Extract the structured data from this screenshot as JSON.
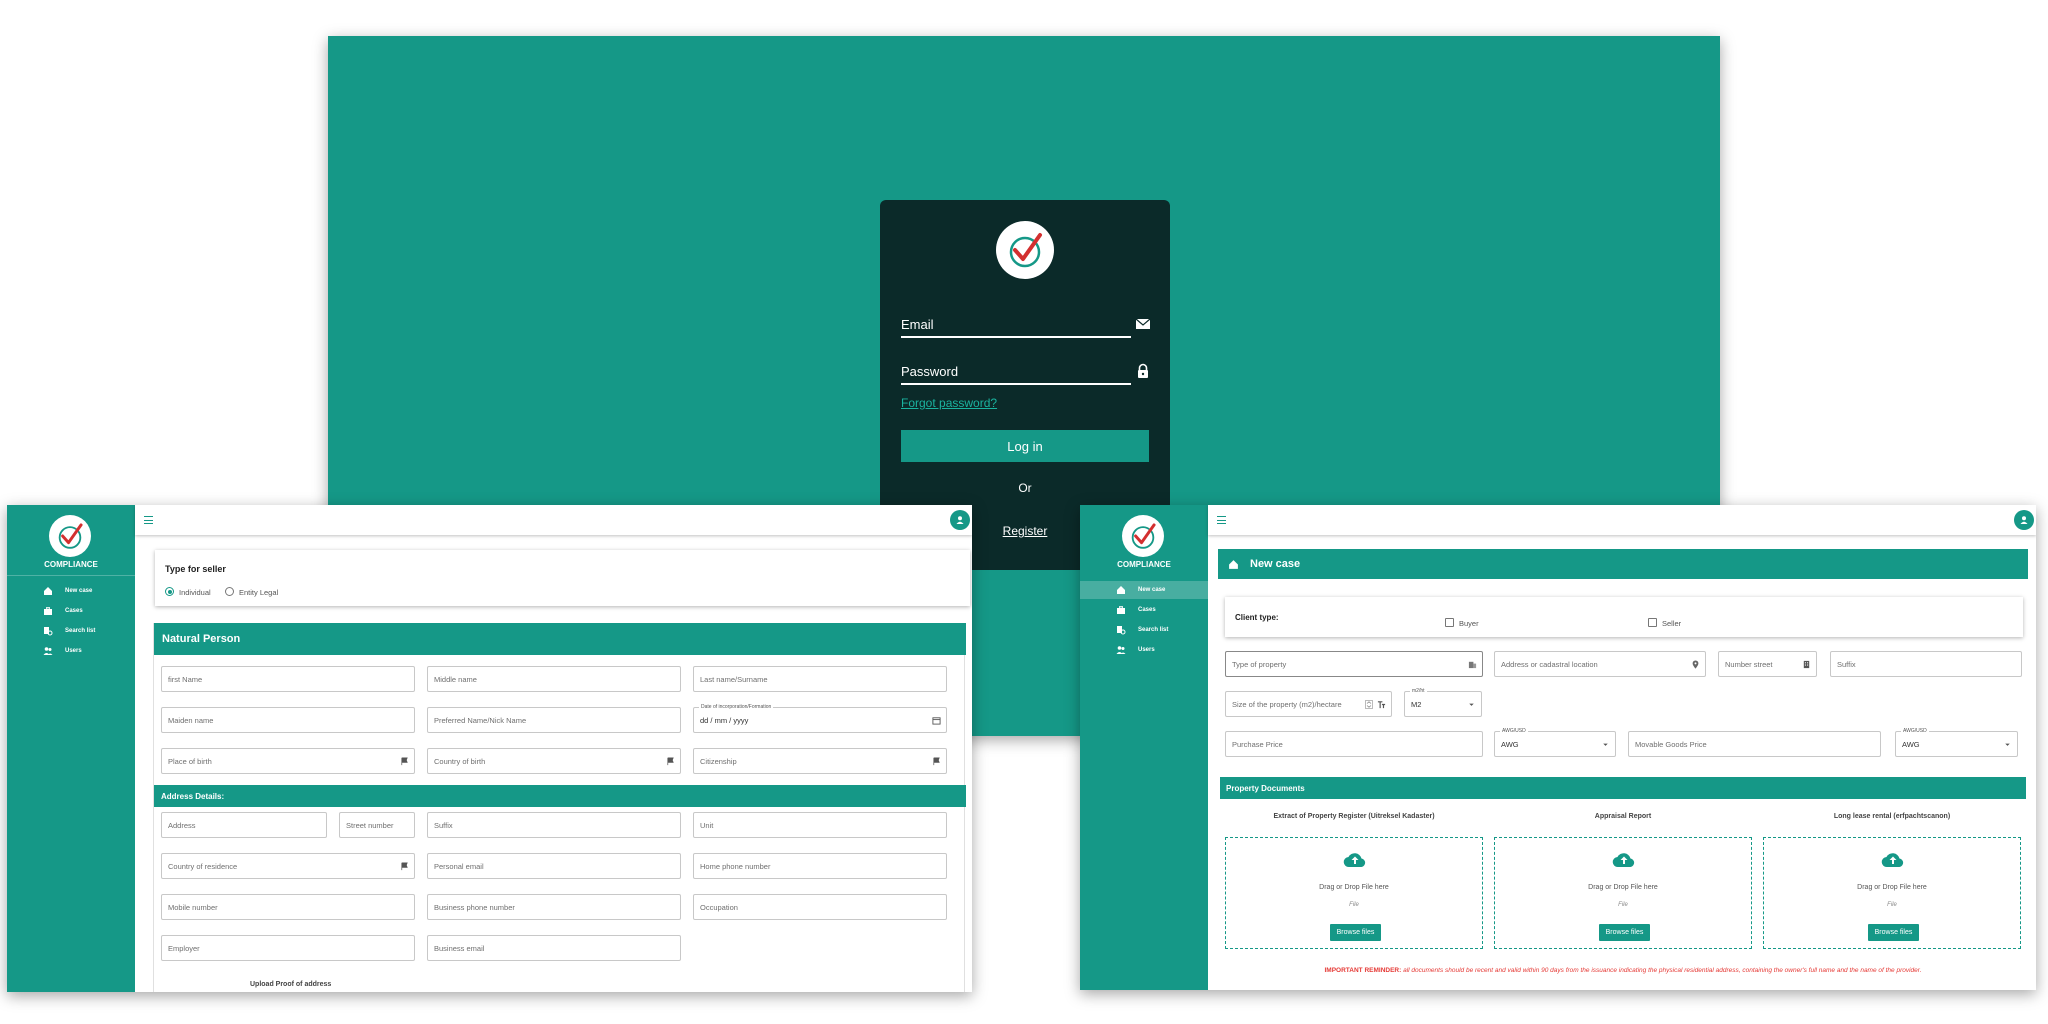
{
  "colors": {
    "accent": "#159887",
    "card_dark": "#0b2a29",
    "reminder": "#e53935"
  },
  "login": {
    "email_placeholder": "Email",
    "password_placeholder": "Password",
    "forgot_link": "Forgot password?",
    "login_button": "Log in",
    "or_text": "Or",
    "register_link": "Register"
  },
  "sidebar": {
    "title": "COMPLIANCE",
    "items": [
      {
        "label": "New case",
        "icon": "add-home-icon"
      },
      {
        "label": "Cases",
        "icon": "briefcase-icon"
      },
      {
        "label": "Search list",
        "icon": "search-list-icon"
      },
      {
        "label": "Users",
        "icon": "users-icon"
      }
    ]
  },
  "seller_form": {
    "type_title": "Type for seller",
    "radio_options": [
      "Individual",
      "Entity Legal"
    ],
    "selected_option": "Individual",
    "section_title": "Natural Person",
    "fields": {
      "first_name": "first Name",
      "middle_name": "Middle name",
      "last_name": "Last name/Surname",
      "maiden_name": "Maiden name",
      "preferred_name": "Preferred Name/Nick Name",
      "date_label": "Date of incorporation/Formation",
      "date_value": "dd / mm / yyyy",
      "place_of_birth": "Place of birth",
      "country_of_birth": "Country of birth",
      "citizenship": "Citizenship"
    },
    "address_title": "Address Details:",
    "address_fields": {
      "address": "Address",
      "street_number": "Street number",
      "suffix": "Suffix",
      "unit": "Unit",
      "country_of_residence": "Country of residence",
      "personal_email": "Personal email",
      "home_phone": "Home phone number",
      "mobile": "Mobile number",
      "business_phone": "Business phone number",
      "occupation": "Occupation",
      "employer": "Employer",
      "business_email": "Business email"
    },
    "upload_label": "Upload Proof of address"
  },
  "new_case": {
    "header_title": "New case",
    "client_type_label": "Client type:",
    "client_options": [
      "Buyer",
      "Seller"
    ],
    "fields": {
      "type_of_property": "Type of property",
      "address": "Address or cadastral location",
      "number_street": "Number street",
      "suffix": "Suffix",
      "size": "Size of the property (m2)/hectare",
      "unit_label": "m2/ht",
      "unit_value": "M2",
      "purchase_price": "Purchase Price",
      "currency_label": "AWG/USD",
      "currency_value": "AWG",
      "movable_goods": "Movable Goods Price",
      "currency2_label": "AWG/USD",
      "currency2_value": "AWG"
    },
    "documents_title": "Property Documents",
    "documents": [
      {
        "title": "Extract of Property Register (Uitreksel Kadaster)",
        "drag_text": "Drag or Drop File here",
        "file_text": "File",
        "button": "Browse files"
      },
      {
        "title": "Appraisal Report",
        "drag_text": "Drag or Drop File here",
        "file_text": "File",
        "button": "Browse files"
      },
      {
        "title": "Long lease rental (erfpachtscanon)",
        "drag_text": "Drag or Drop File here",
        "file_text": "File",
        "button": "Browse files"
      }
    ],
    "reminder_label": "IMPORTANT REMINDER:",
    "reminder_text": "all documents should be recent and valid within 90 days from the issuance indicating the physical residential address, containing the owner's full name and the name of the provider."
  }
}
